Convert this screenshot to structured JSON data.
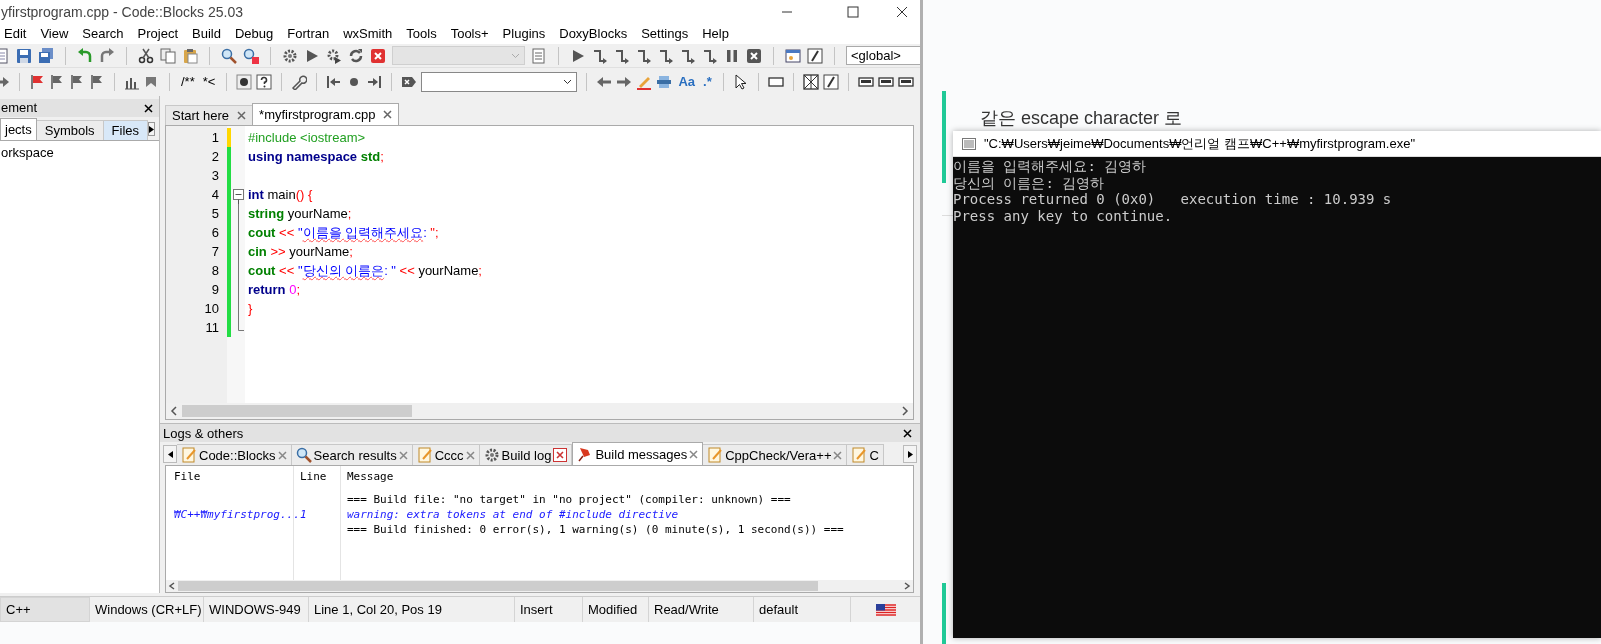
{
  "ide": {
    "title": "yfirstprogram.cpp - Code::Blocks 25.03",
    "menu": [
      "Edit",
      "View",
      "Search",
      "Project",
      "Build",
      "Debug",
      "Fortran",
      "wxSmith",
      "Tools",
      "Tools+",
      "Plugins",
      "DoxyBlocks",
      "Settings",
      "Help"
    ],
    "scope_combo": "<global>",
    "comment_buttons": [
      "/**",
      "*<"
    ],
    "search_buttons": [
      "Aa",
      ".*"
    ],
    "management": {
      "title": "ement",
      "tabs": [
        {
          "label": "jects",
          "selected": true,
          "hovered": false
        },
        {
          "label": "Symbols",
          "selected": false,
          "hovered": false
        },
        {
          "label": "Files",
          "selected": false,
          "hovered": true
        }
      ],
      "tree": [
        {
          "label": "orkspace"
        }
      ]
    },
    "editor_tabs": [
      {
        "label": "Start here",
        "selected": false
      },
      {
        "label": "*myfirstprogram.cpp",
        "selected": true
      }
    ],
    "code_lines": [
      {
        "number": "1",
        "modified": true,
        "fold_start": false,
        "in_fold": false,
        "tokens": [
          {
            "kind": "preproc",
            "text": "#include <iostream>"
          }
        ]
      },
      {
        "number": "2",
        "modified": false,
        "fold_start": false,
        "in_fold": false,
        "tokens": [
          {
            "kind": "keyword",
            "text": "using namespace "
          },
          {
            "kind": "type",
            "text": "std"
          },
          {
            "kind": "op",
            "text": ";"
          }
        ]
      },
      {
        "number": "3",
        "modified": false,
        "fold_start": false,
        "in_fold": false
      },
      {
        "number": "4",
        "modified": false,
        "fold_start": true,
        "in_fold": false,
        "tokens": [
          {
            "kind": "keyword",
            "text": "int"
          },
          {
            "kind": "text",
            "text": " main"
          },
          {
            "kind": "op",
            "text": "() {"
          }
        ]
      },
      {
        "number": "5",
        "modified": false,
        "fold_start": false,
        "in_fold": true,
        "tokens": [
          {
            "kind": "type",
            "text": "string"
          },
          {
            "kind": "text",
            "text": " yourName"
          },
          {
            "kind": "op",
            "text": ";"
          }
        ]
      },
      {
        "number": "6",
        "modified": false,
        "fold_start": false,
        "in_fold": true,
        "tokens": [
          {
            "kind": "type",
            "text": "cout"
          },
          {
            "kind": "op",
            "text": " << "
          },
          {
            "kind": "string",
            "text": "\""
          },
          {
            "kind": "string",
            "text": "이름을 입력해주세요",
            "misspelled": true
          },
          {
            "kind": "string",
            "text": ": "
          },
          {
            "kind": "op",
            "text": "\";"
          }
        ]
      },
      {
        "number": "7",
        "modified": false,
        "fold_start": false,
        "in_fold": true,
        "tokens": [
          {
            "kind": "type",
            "text": "cin"
          },
          {
            "kind": "op",
            "text": " >> "
          },
          {
            "kind": "text",
            "text": "yourName"
          },
          {
            "kind": "op",
            "text": ";"
          }
        ]
      },
      {
        "number": "8",
        "modified": false,
        "fold_start": false,
        "in_fold": true,
        "tokens": [
          {
            "kind": "type",
            "text": "cout"
          },
          {
            "kind": "op",
            "text": " << "
          },
          {
            "kind": "string",
            "text": "\""
          },
          {
            "kind": "string",
            "text": "당신의 이름은",
            "misspelled": true
          },
          {
            "kind": "string",
            "text": ": \""
          },
          {
            "kind": "op",
            "text": " << "
          },
          {
            "kind": "text",
            "text": "yourName"
          },
          {
            "kind": "op",
            "text": ";"
          }
        ]
      },
      {
        "number": "9",
        "modified": false,
        "fold_start": false,
        "in_fold": true,
        "tokens": [
          {
            "kind": "keyword",
            "text": "return"
          },
          {
            "kind": "number",
            "text": " 0"
          },
          {
            "kind": "op",
            "text": ";"
          }
        ]
      },
      {
        "number": "10",
        "modified": false,
        "fold_start": false,
        "in_fold": true,
        "tokens": [
          {
            "kind": "op",
            "text": "}"
          }
        ]
      },
      {
        "number": "11",
        "modified": false,
        "fold_start": false,
        "in_fold": true
      }
    ],
    "logs": {
      "title": "Logs & others",
      "tabs": [
        {
          "label": "Code::Blocks",
          "kind": "note",
          "selected": false,
          "close_hovered": false
        },
        {
          "label": "Search results",
          "kind": "search",
          "selected": false,
          "close_hovered": false
        },
        {
          "label": "Cccc",
          "kind": "note",
          "selected": false,
          "close_hovered": false
        },
        {
          "label": "Build log",
          "kind": "gear",
          "selected": false,
          "close_hovered": true
        },
        {
          "label": "Build messages",
          "kind": "pin",
          "selected": true,
          "close_hovered": false
        },
        {
          "label": "CppCheck/Vera++",
          "kind": "note",
          "selected": false,
          "close_hovered": false
        },
        {
          "label": "C",
          "kind": "note",
          "selected": false,
          "close_hovered": false
        }
      ],
      "columns": [
        "File",
        "Line",
        "Message"
      ],
      "rows": [
        {
          "kind": "info",
          "message": "=== Build file: \"no target\" in \"no project\" (compiler: unknown) ==="
        },
        {
          "kind": "warning",
          "file": "₩C++₩myfirstprog...",
          "line": "1",
          "message": "warning: extra tokens at end of #include directive"
        },
        {
          "kind": "info",
          "message": "=== Build finished: 0 error(s), 1 warning(s) (0 minute(s), 1 second(s)) ==="
        }
      ]
    },
    "status_bar": [
      "C++",
      "Windows (CR+LF)",
      "WINDOWS-949",
      "Line 1, Col 20, Pos 19",
      "Insert",
      "Modified",
      "Read/Write",
      "default"
    ]
  },
  "page": {
    "quote_text": "같은 escape character 로"
  },
  "console": {
    "title": "\"C:₩Users₩jeime₩Documents₩언리얼 캠프₩C++₩myfirstprogram.exe\"",
    "lines": [
      "이름을 입력해주세요: 김영하",
      "당신의 이름은: 김영하",
      "Process returned 0 (0x0)   execution time : 10.939 s",
      "Press any key to continue."
    ]
  }
}
